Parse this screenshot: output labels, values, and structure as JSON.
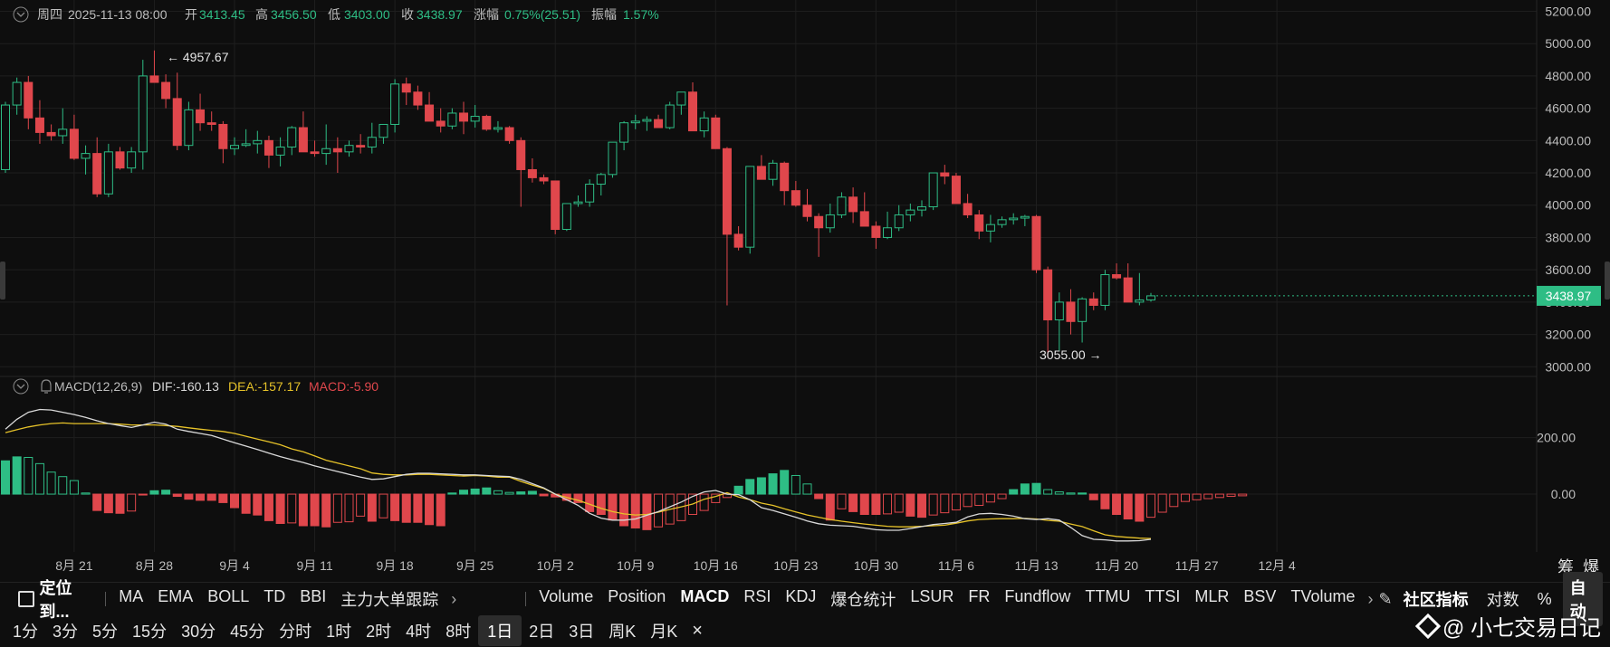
{
  "header": {
    "day": "周四",
    "date": "2025-11-13 08:00",
    "open_label": "开",
    "open": "3413.45",
    "high_label": "高",
    "high": "3456.50",
    "low_label": "低",
    "low": "3403.00",
    "close_label": "收",
    "close": "3438.97",
    "change_label": "涨幅",
    "change": "0.75%(25.51)",
    "amp_label": "振幅",
    "amp": "1.57%"
  },
  "macd_header": {
    "name": "MACD(12,26,9)",
    "dif": "DIF:-160.13",
    "dea": "DEA:-157.17",
    "macd": "MACD:-5.90"
  },
  "price_annotations": {
    "high": "4957.67",
    "low": "3055.00"
  },
  "last_price": "3438.97",
  "corner_labels": [
    "筹",
    "爆"
  ],
  "indicator_bar": {
    "locate_label": "定位到...",
    "overlays": [
      "MA",
      "EMA",
      "BOLL",
      "TD",
      "BBI",
      "主力大单跟踪"
    ],
    "subs": [
      "Volume",
      "Position",
      "MACD",
      "RSI",
      "KDJ",
      "爆仓统计",
      "LSUR",
      "FR",
      "Fundflow",
      "TTMU",
      "TTSI",
      "MLR",
      "BSV",
      "TVolume"
    ],
    "active_sub": "MACD",
    "community_label": "社区指标",
    "log_label": "对数",
    "pct_label": "%",
    "auto_label": "自动"
  },
  "timeframes": [
    "1分",
    "3分",
    "5分",
    "15分",
    "30分",
    "45分",
    "分时",
    "1时",
    "2时",
    "4时",
    "8时",
    "1日",
    "2日",
    "3日",
    "周K",
    "月K"
  ],
  "active_timeframe": "1日",
  "brand": "@ 小七交易日记",
  "colors": {
    "up": "#2ebd85",
    "down": "#e0474c",
    "dif": "#d9d9d9",
    "dea": "#e6c229",
    "bg": "#0e0e0e",
    "grid": "#1e1e1e"
  },
  "chart_data": [
    {
      "type": "candlestick",
      "title": "",
      "x_ticks": [
        "8月 21",
        "8月 28",
        "9月 4",
        "9月 11",
        "9月 18",
        "9月 25",
        "10月 2",
        "10月 9",
        "10月 16",
        "10月 23",
        "10月 30",
        "11月 6",
        "11月 13",
        "11月 20",
        "11月 27",
        "12月 4"
      ],
      "y_ticks": [
        3000,
        3200,
        3400,
        3600,
        3800,
        4000,
        4200,
        4400,
        4600,
        4800,
        5000,
        5200
      ],
      "ylim": [
        2940,
        5270
      ],
      "start_date": "2025-08-15",
      "ohlc": [
        [
          4220,
          4640,
          4200,
          4620
        ],
        [
          4620,
          4790,
          4560,
          4760
        ],
        [
          4760,
          4800,
          4470,
          4540
        ],
        [
          4540,
          4650,
          4380,
          4450
        ],
        [
          4450,
          4500,
          4400,
          4430
        ],
        [
          4430,
          4600,
          4380,
          4470
        ],
        [
          4470,
          4560,
          4280,
          4290
        ],
        [
          4290,
          4370,
          4190,
          4320
        ],
        [
          4320,
          4420,
          4050,
          4070
        ],
        [
          4070,
          4380,
          4050,
          4330
        ],
        [
          4330,
          4360,
          4220,
          4230
        ],
        [
          4230,
          4360,
          4200,
          4330
        ],
        [
          4330,
          4900,
          4220,
          4800
        ],
        [
          4800,
          4957.67,
          4760,
          4760
        ],
        [
          4760,
          4810,
          4600,
          4660
        ],
        [
          4660,
          4820,
          4340,
          4370
        ],
        [
          4370,
          4640,
          4340,
          4590
        ],
        [
          4590,
          4690,
          4460,
          4510
        ],
        [
          4510,
          4580,
          4460,
          4500
        ],
        [
          4500,
          4520,
          4260,
          4350
        ],
        [
          4350,
          4420,
          4310,
          4370
        ],
        [
          4370,
          4470,
          4360,
          4380
        ],
        [
          4380,
          4460,
          4320,
          4400
        ],
        [
          4400,
          4430,
          4230,
          4310
        ],
        [
          4310,
          4420,
          4240,
          4360
        ],
        [
          4360,
          4490,
          4310,
          4480
        ],
        [
          4480,
          4580,
          4380,
          4330
        ],
        [
          4330,
          4400,
          4300,
          4320
        ],
        [
          4320,
          4500,
          4250,
          4350
        ],
        [
          4350,
          4420,
          4200,
          4330
        ],
        [
          4330,
          4400,
          4300,
          4370
        ],
        [
          4370,
          4440,
          4320,
          4360
        ],
        [
          4360,
          4510,
          4320,
          4420
        ],
        [
          4420,
          4480,
          4380,
          4500
        ],
        [
          4500,
          4780,
          4450,
          4750
        ],
        [
          4750,
          4790,
          4620,
          4700
        ],
        [
          4700,
          4740,
          4590,
          4620
        ],
        [
          4620,
          4700,
          4520,
          4520
        ],
        [
          4520,
          4600,
          4450,
          4490
        ],
        [
          4490,
          4600,
          4470,
          4570
        ],
        [
          4570,
          4640,
          4440,
          4520
        ],
        [
          4520,
          4620,
          4480,
          4550
        ],
        [
          4550,
          4560,
          4460,
          4470
        ],
        [
          4470,
          4520,
          4450,
          4480
        ],
        [
          4480,
          4490,
          4380,
          4400
        ],
        [
          4400,
          4420,
          3990,
          4220
        ],
        [
          4220,
          4290,
          4140,
          4170
        ],
        [
          4170,
          4190,
          4130,
          4150
        ],
        [
          4150,
          4150,
          3820,
          3850
        ],
        [
          3850,
          4010,
          3840,
          4010
        ],
        [
          4010,
          4060,
          3990,
          4020
        ],
        [
          4020,
          4160,
          3990,
          4130
        ],
        [
          4130,
          4200,
          4060,
          4190
        ],
        [
          4190,
          4370,
          4170,
          4390
        ],
        [
          4390,
          4520,
          4340,
          4510
        ],
        [
          4510,
          4560,
          4470,
          4520
        ],
        [
          4520,
          4550,
          4460,
          4530
        ],
        [
          4530,
          4560,
          4510,
          4480
        ],
        [
          4480,
          4640,
          4470,
          4620
        ],
        [
          4620,
          4670,
          4560,
          4700
        ],
        [
          4700,
          4760,
          4460,
          4460
        ],
        [
          4460,
          4580,
          4420,
          4540
        ],
        [
          4540,
          4560,
          4380,
          4350
        ],
        [
          4350,
          4360,
          3380,
          3820
        ],
        [
          3820,
          3870,
          3720,
          3740
        ],
        [
          3740,
          4200,
          3700,
          4240
        ],
        [
          4240,
          4310,
          4160,
          4160
        ],
        [
          4160,
          4280,
          4120,
          4260
        ],
        [
          4260,
          4270,
          4000,
          4090
        ],
        [
          4090,
          4150,
          3990,
          4000
        ],
        [
          4000,
          4100,
          3900,
          3930
        ],
        [
          3930,
          3950,
          3680,
          3860
        ],
        [
          3860,
          4010,
          3830,
          3940
        ],
        [
          3940,
          4080,
          3920,
          4050
        ],
        [
          4050,
          4110,
          3890,
          3960
        ],
        [
          3960,
          4080,
          3880,
          3870
        ],
        [
          3870,
          3900,
          3730,
          3800
        ],
        [
          3800,
          3960,
          3790,
          3860
        ],
        [
          3860,
          4000,
          3840,
          3940
        ],
        [
          3940,
          4010,
          3900,
          3970
        ],
        [
          3970,
          4030,
          3930,
          3990
        ],
        [
          3990,
          4200,
          3970,
          4200
        ],
        [
          4200,
          4250,
          4130,
          4180
        ],
        [
          4180,
          4200,
          4020,
          4010
        ],
        [
          4010,
          4070,
          3920,
          3940
        ],
        [
          3940,
          3970,
          3790,
          3840
        ],
        [
          3840,
          3940,
          3770,
          3880
        ],
        [
          3880,
          3930,
          3860,
          3910
        ],
        [
          3910,
          3950,
          3880,
          3920
        ],
        [
          3920,
          3940,
          3870,
          3930
        ],
        [
          3930,
          3940,
          3580,
          3600
        ],
        [
          3600,
          3620,
          3055,
          3290
        ],
        [
          3290,
          3460,
          3100,
          3400
        ],
        [
          3400,
          3480,
          3200,
          3280
        ],
        [
          3280,
          3430,
          3150,
          3420
        ],
        [
          3420,
          3460,
          3350,
          3380
        ],
        [
          3380,
          3600,
          3350,
          3570
        ],
        [
          3570,
          3640,
          3540,
          3550
        ],
        [
          3550,
          3640,
          3400,
          3400
        ],
        [
          3400,
          3580,
          3380,
          3413.45
        ],
        [
          3413.45,
          3456.5,
          3403,
          3438.97
        ]
      ]
    },
    {
      "type": "macd",
      "title": "MACD(12,26,9)",
      "y_ticks": [
        0,
        200
      ],
      "ylim": [
        -205,
        340
      ],
      "dif": [
        230,
        265,
        290,
        300,
        298,
        290,
        282,
        272,
        260,
        250,
        243,
        236,
        245,
        255,
        248,
        230,
        222,
        215,
        208,
        195,
        182,
        170,
        158,
        145,
        133,
        122,
        112,
        100,
        90,
        80,
        70,
        60,
        52,
        54,
        62,
        70,
        74,
        74,
        72,
        70,
        68,
        68,
        66,
        64,
        62,
        52,
        37,
        22,
        0,
        -20,
        -40,
        -68,
        -85,
        -92,
        -92,
        -88,
        -75,
        -62,
        -45,
        -28,
        -8,
        8,
        13,
        0,
        -2,
        -20,
        -48,
        -58,
        -70,
        -82,
        -95,
        -105,
        -110,
        -112,
        -114,
        -120,
        -126,
        -128,
        -128,
        -122,
        -115,
        -108,
        -104,
        -100,
        -81,
        -70,
        -68,
        -72,
        -78,
        -87,
        -90,
        -87,
        -92,
        -118,
        -147,
        -160,
        -162,
        -166,
        -166,
        -165,
        -160.13
      ],
      "dea": [
        218,
        228,
        238,
        245,
        250,
        252,
        250,
        250,
        250,
        250,
        248,
        245,
        245,
        245,
        243,
        240,
        235,
        230,
        226,
        222,
        215,
        205,
        195,
        185,
        175,
        160,
        150,
        135,
        120,
        110,
        100,
        90,
        75,
        70,
        68,
        68,
        70,
        70,
        68,
        66,
        64,
        66,
        64,
        60,
        60,
        45,
        32,
        20,
        0,
        -12,
        -22,
        -36,
        -50,
        -62,
        -70,
        -74,
        -72,
        -64,
        -54,
        -45,
        -35,
        -18,
        -8,
        5,
        -10,
        -20,
        -32,
        -40,
        -52,
        -63,
        -74,
        -82,
        -90,
        -96,
        -101,
        -106,
        -110,
        -114,
        -116,
        -116,
        -114,
        -112,
        -110,
        -103,
        -95,
        -90,
        -88,
        -87,
        -87,
        -86,
        -88,
        -93,
        -96,
        -106,
        -115,
        -130,
        -144,
        -150,
        -153,
        -156,
        -157.17
      ],
      "macd": [
        118,
        132,
        130,
        108,
        78,
        62,
        48,
        4,
        -58,
        -66,
        -68,
        -60,
        -2,
        12,
        14,
        -8,
        -18,
        -22,
        -22,
        -30,
        -48,
        -68,
        -74,
        -94,
        -104,
        -102,
        -112,
        -112,
        -116,
        -100,
        -98,
        -78,
        -96,
        -84,
        -94,
        -100,
        -100,
        -108,
        -112,
        4,
        14,
        18,
        22,
        12,
        6,
        8,
        10,
        -6,
        -10,
        -22,
        -30,
        -62,
        -72,
        -92,
        -112,
        -120,
        -126,
        -116,
        -106,
        -94,
        -72,
        -58,
        -30,
        -12,
        28,
        52,
        58,
        72,
        84,
        66,
        36,
        -16,
        -92,
        -52,
        -62,
        -72,
        -72,
        -70,
        -64,
        -78,
        -82,
        -74,
        -66,
        -56,
        -44,
        -40,
        -28,
        -16,
        16,
        36,
        38,
        16,
        8,
        4,
        4,
        -20,
        -52,
        -72,
        -88,
        -96,
        -82,
        -64,
        -44,
        -26,
        -20,
        -16,
        -12,
        -8,
        -5.9
      ]
    }
  ]
}
